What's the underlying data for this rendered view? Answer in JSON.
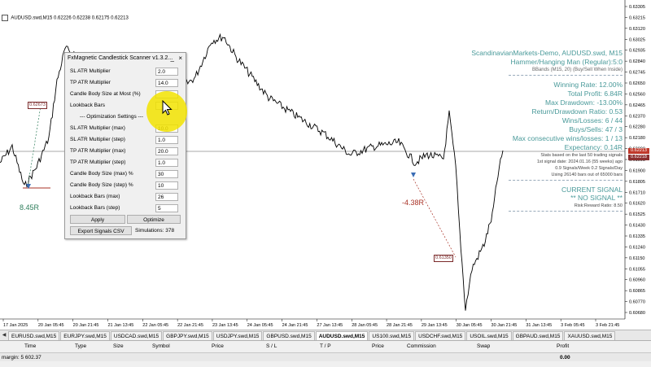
{
  "chart": {
    "symbol": "AUDUSD.swd,M15",
    "ohlc": "0.62226 0.62238 0.62175 0.62213",
    "price_axis": [
      "0.63305",
      "0.63215",
      "0.63120",
      "0.63025",
      "0.62935",
      "0.62840",
      "0.62745",
      "0.62650",
      "0.62560",
      "0.62465",
      "0.62370",
      "0.62280",
      "0.62180",
      "0.62090",
      "0.61995",
      "0.61900",
      "0.61805",
      "0.61710",
      "0.61620",
      "0.61525",
      "0.61430",
      "0.61335",
      "0.61240",
      "0.61150",
      "0.61055",
      "0.60960",
      "0.60865",
      "0.60770",
      "0.60680"
    ],
    "time_axis": [
      "17 Jan 2025",
      "20 Jan 05:45",
      "20 Jan 21:45",
      "21 Jan 13:45",
      "22 Jan 05:45",
      "22 Jan 21:45",
      "23 Jan 13:45",
      "24 Jan 05:45",
      "24 Jan 21:45",
      "27 Jan 13:45",
      "28 Jan 05:45",
      "28 Jan 21:45",
      "29 Jan 13:45",
      "30 Jan 05:45",
      "30 Jan 21:45",
      "31 Jan 13:45",
      "3 Feb 05:45",
      "3 Feb 21:45"
    ],
    "current_price": "0.62213",
    "current_price_alt": "0.62218",
    "annotations": {
      "left_box": "0.62673",
      "left_result": "8.45R",
      "mid_result": "-4.38R",
      "mid_box": "0.61350"
    },
    "colors": {
      "accent": "#4a9a9a",
      "loss": "#a93226",
      "win": "#2e7d5b",
      "sell_line": "#c0392b"
    }
  },
  "stats": {
    "account": "ScandinavianMarkets-Demo, AUDUSD.swd, M15",
    "pattern": "Hammer/Hanging Man (Regular):5:0",
    "filter": "BBands (M15, 20) (Buy/Sell When Inside)",
    "winning_rate": "Winning Rate: 12.00%",
    "total_profit": "Total Profit: 6.84R",
    "max_drawdown": "Max Drawdown: -13.00%",
    "return_dd": "Return/Drawdown Ratio: 0.53",
    "wins_losses": "Wins/Losses: 6 / 44",
    "buys_sells": "Buys/Sells: 47 / 3",
    "consecutive": "Max consecutive wins/losses: 1 / 13",
    "expectancy": "Expectancy: 0.14R",
    "based_on": "Stats based on the last 50 trading signals",
    "first_signal": "1st signal date: 2024.01.16 (55 weeks) ago",
    "signals_week": "0.9 Signals/Week   0.2 Signals/Day",
    "using_bars": "Using 26140 bars out of 65000 bars",
    "current_signal": "CURRENT SIGNAL",
    "no_signal": "** NO SIGNAL **",
    "risk_reward": "Risk:Reward Ratio: 8.50"
  },
  "scanner": {
    "title": "FxMagnetic Candlestick Scanner v1.3.2...",
    "minimize": "_",
    "close": "×",
    "fields": [
      {
        "label": "SL ATR Multiplier",
        "value": "2.0"
      },
      {
        "label": "TP ATR Multiplier",
        "value": "14.0"
      },
      {
        "label": "Candle Body Size at Most (%)",
        "value": ""
      },
      {
        "label": "Lookback Bars",
        "value": ""
      }
    ],
    "optimization_title": "--- Optimization Settings ---",
    "opt_fields": [
      {
        "label": "SL ATR Multiplier (max)",
        "value": "10.0"
      },
      {
        "label": "SL ATR Multiplier (step)",
        "value": "1.0"
      },
      {
        "label": "TP ATR Multiplier (max)",
        "value": "20.0"
      },
      {
        "label": "TP ATR Multiplier (step)",
        "value": "1.0"
      },
      {
        "label": "Candle Body Size (max) %",
        "value": "30"
      },
      {
        "label": "Candle Body Size (step) %",
        "value": "10"
      },
      {
        "label": "Lookback Bars (max)",
        "value": "26"
      },
      {
        "label": "Lookback Bars (step)",
        "value": "5"
      }
    ],
    "apply": "Apply",
    "optimize": "Optimize",
    "export": "Export Signals CSV",
    "simulations": "Simulations: 378"
  },
  "tabs": {
    "items": [
      "EURUSD.swd,M15",
      "EURJPY.swd,M15",
      "USDCAD.swd,M15",
      "GBPJPY.swd,M15",
      "USDJPY.swd,M15",
      "GBPUSD.swd,M15",
      "AUDUSD.swd,M15",
      "US100.swd,M15",
      "USDCHF.swd,M15",
      "USOIL.swd,M15",
      "GBPAUD.swd,M15",
      "XAUUSD.swd,M15"
    ],
    "active_index": 6
  },
  "terminal": {
    "columns": [
      "Time",
      "Type",
      "Size",
      "Symbol",
      "Price",
      "S / L",
      "T / P",
      "Price",
      "Commission",
      "Swap",
      "Profit"
    ],
    "balance": "margin: 5 602.37",
    "total": "0.00"
  }
}
